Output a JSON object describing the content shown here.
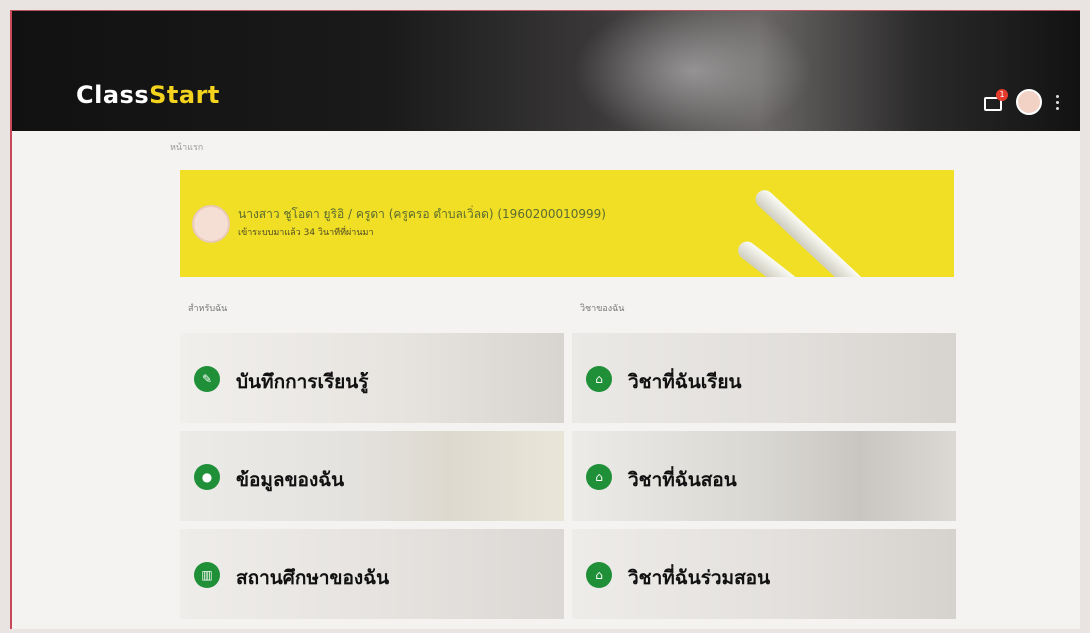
{
  "brand": {
    "part1": "Class",
    "part2": "Start",
    "color_white": "#ffffff",
    "color_yellow": "#f3d31e"
  },
  "header": {
    "notification_count": "1",
    "icons": [
      "message-icon",
      "user-avatar-icon",
      "more-vert-icon"
    ]
  },
  "breadcrumb": "หน้าแรก",
  "banner": {
    "name": "นางสาว ชูโอดา ยูริอิ / ครูดา (ครูครอ ตำบลเวิ่ลด) (1960200010999)",
    "note": "เข้าระบบมาแล้ว 34 วินาทีที่ผ่านมา",
    "background": "#f1df25"
  },
  "sections": {
    "left_label": "สำหรับฉัน",
    "right_label": "วิชาของฉัน"
  },
  "tiles_left": [
    {
      "label": "บันทึกการเรียนรู้",
      "icon": "pencil-icon"
    },
    {
      "label": "ข้อมูลของฉัน",
      "icon": "user-icon"
    },
    {
      "label": "สถานศึกษาของฉัน",
      "icon": "building-icon"
    }
  ],
  "tiles_right": [
    {
      "label": "วิชาที่ฉันเรียน",
      "icon": "home-icon"
    },
    {
      "label": "วิชาที่ฉันสอน",
      "icon": "home-icon"
    },
    {
      "label": "วิชาที่ฉันร่วมสอน",
      "icon": "home-icon"
    }
  ],
  "accent_green": "#1f8f38"
}
